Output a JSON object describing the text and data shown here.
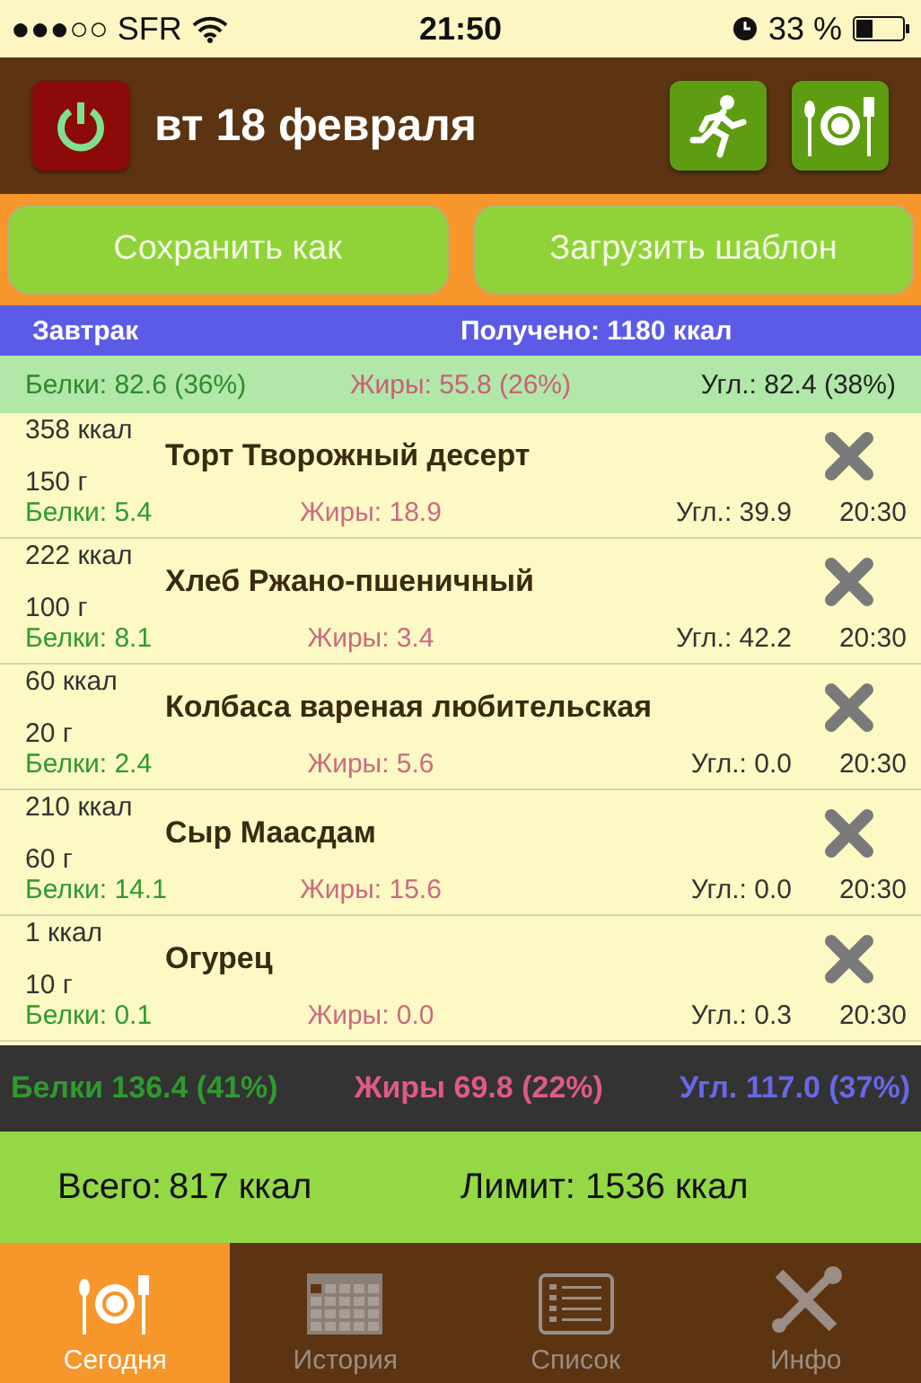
{
  "status_bar": {
    "carrier": "●●●○○ SFR",
    "time": "21:50",
    "battery_text": "33 %"
  },
  "header": {
    "date": "вт 18 февраля"
  },
  "actions": [
    "Сохранить как",
    "Загрузить шаблон"
  ],
  "meal": {
    "name": "Завтрак",
    "received": "Получено: 1180 ккал"
  },
  "meal_macros": {
    "protein": "Белки: 82.6 (36%)",
    "fat": "Жиры: 55.8 (26%)",
    "carbs": "Угл.: 82.4 (38%)"
  },
  "items": [
    {
      "kcal": "358 ккал",
      "weight": "150 г",
      "name": "Торт Творожный десерт",
      "protein": "Белки: 5.4",
      "fat": "Жиры: 18.9",
      "carbs": "Угл.: 39.9",
      "time": "20:30"
    },
    {
      "kcal": "222 ккал",
      "weight": "100 г",
      "name": "Хлеб Ржано-пшеничный",
      "protein": "Белки: 8.1",
      "fat": "Жиры: 3.4",
      "carbs": "Угл.: 42.2",
      "time": "20:30"
    },
    {
      "kcal": "60 ккал",
      "weight": "20 г",
      "name": "Колбаса вареная любительская",
      "protein": "Белки: 2.4",
      "fat": "Жиры: 5.6",
      "carbs": "Угл.: 0.0",
      "time": "20:30"
    },
    {
      "kcal": "210 ккал",
      "weight": "60 г",
      "name": "Сыр Маасдам",
      "protein": "Белки: 14.1",
      "fat": "Жиры: 15.6",
      "carbs": "Угл.: 0.0",
      "time": "20:30"
    },
    {
      "kcal": "1 ккал",
      "weight": "10 г",
      "name": "Огурец",
      "protein": "Белки: 0.1",
      "fat": "Жиры: 0.0",
      "carbs": "Угл.: 0.3",
      "time": "20:30"
    }
  ],
  "totals": {
    "protein": "Белки 136.4 (41%)",
    "fat": "Жиры 69.8 (22%)",
    "carbs": "Угл. 117.0 (37%)"
  },
  "summary": {
    "total_label": "Всего:",
    "total_value": "817 ккал",
    "limit": "Лимит: 1536 ккал"
  },
  "tabs": [
    {
      "kind": "plate",
      "label": "Сегодня",
      "selected": true
    },
    {
      "kind": "calendar",
      "label": "История",
      "selected": false
    },
    {
      "kind": "list",
      "label": "Список",
      "selected": false
    },
    {
      "kind": "tools",
      "label": "Инфо",
      "selected": false
    }
  ]
}
